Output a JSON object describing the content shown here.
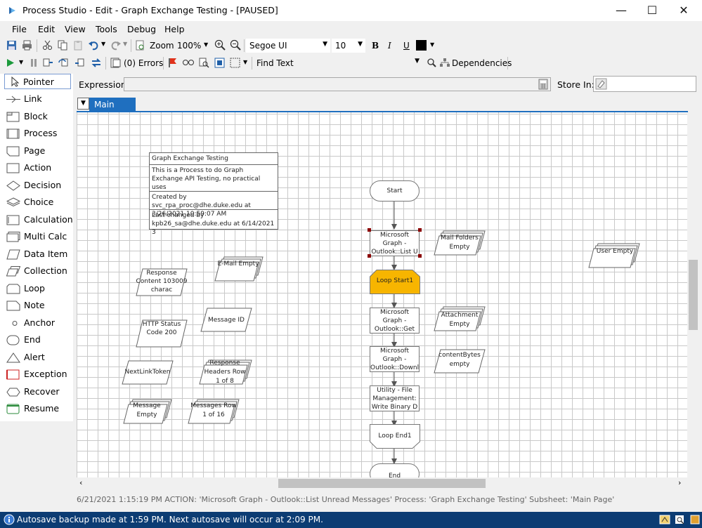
{
  "window": {
    "title": "Process Studio  - Edit - Graph Exchange Testing - [PAUSED]",
    "minimize": "—",
    "maximize": "☐",
    "close": "✕"
  },
  "menu": [
    "File",
    "Edit",
    "View",
    "Tools",
    "Debug",
    "Help"
  ],
  "toolbar1": {
    "zoom_label": "Zoom",
    "zoom_value": "100%",
    "font_name": "Segoe UI",
    "font_size": "10",
    "bold": "B",
    "italic": "I",
    "underline": "U"
  },
  "toolbar2": {
    "errors": "(0) Errors",
    "find_text": "Find Text",
    "dependencies": "Dependencies"
  },
  "palette": [
    {
      "label": "Pointer",
      "icon": "pointer-icon"
    },
    {
      "label": "Link",
      "icon": "link-icon"
    },
    {
      "label": "Block",
      "icon": "block-icon"
    },
    {
      "label": "Process",
      "icon": "process-icon"
    },
    {
      "label": "Page",
      "icon": "page-icon"
    },
    {
      "label": "Action",
      "icon": "action-icon"
    },
    {
      "label": "Decision",
      "icon": "decision-icon"
    },
    {
      "label": "Choice",
      "icon": "choice-icon"
    },
    {
      "label": "Calculation",
      "icon": "calculation-icon"
    },
    {
      "label": "Multi Calc",
      "icon": "multi-calc-icon"
    },
    {
      "label": "Data Item",
      "icon": "data-item-icon"
    },
    {
      "label": "Collection",
      "icon": "collection-icon"
    },
    {
      "label": "Loop",
      "icon": "loop-icon"
    },
    {
      "label": "Note",
      "icon": "note-icon"
    },
    {
      "label": "Anchor",
      "icon": "anchor-icon"
    },
    {
      "label": "End",
      "icon": "end-icon"
    },
    {
      "label": "Alert",
      "icon": "alert-icon"
    },
    {
      "label": "Exception",
      "icon": "exception-icon"
    },
    {
      "label": "Recover",
      "icon": "recover-icon"
    },
    {
      "label": "Resume",
      "icon": "resume-icon"
    }
  ],
  "expression": {
    "label": "Expression:",
    "value": "",
    "store_in_label": "Store In:",
    "store_in_value": ""
  },
  "tabs": {
    "active": "Main Page"
  },
  "canvas": {
    "info_box": {
      "title": "Graph Exchange Testing",
      "description": "This is a Process to do Graph Exchange API Testing, no practical uses",
      "created": "Created by svc_rpa_proc@dhe.duke.edu at 3/26/2021 10:59:07 AM",
      "changed": "Last changed by kpb26_sa@dhe.duke.edu  at 6/14/2021 3"
    },
    "flow": {
      "start": "Start",
      "stage1": "Microsoft Graph - Outlook::List U",
      "loop_start": "Loop Start1",
      "stage2": "Microsoft Graph - Outlook::Get At",
      "stage3": "Microsoft Graph - Outlook::Downl",
      "stage4": "Utility - File Management: Write Binary D",
      "loop_end": "Loop End1",
      "end": "End"
    },
    "data_items": {
      "response_content": "Response Content 103009 charac",
      "email": "E-Mail Empty",
      "http_status": "HTTP Status Code 200",
      "message_id": "Message ID",
      "next_link": "NextLinkToken",
      "response_headers": "Response Headers Row 1 of 8",
      "message": "Message Empty",
      "messages": "Messages Row 1 of 16",
      "mail_folders": "Mail Folders Empty",
      "attachment": "Attachment Empty",
      "content_bytes": "contentBytes empty",
      "user": "User Empty"
    },
    "loop_color": "#f7b500"
  },
  "log_line": "6/21/2021 1:15:19 PM ACTION: 'Microsoft Graph - Outlook::List Unread Messages' Process: 'Graph Exchange Testing' Subsheet: 'Main Page'",
  "status": {
    "text": "Autosave backup made at 1:59 PM. Next autosave will occur at 2:09 PM.",
    "bg": "#0c3c73"
  }
}
